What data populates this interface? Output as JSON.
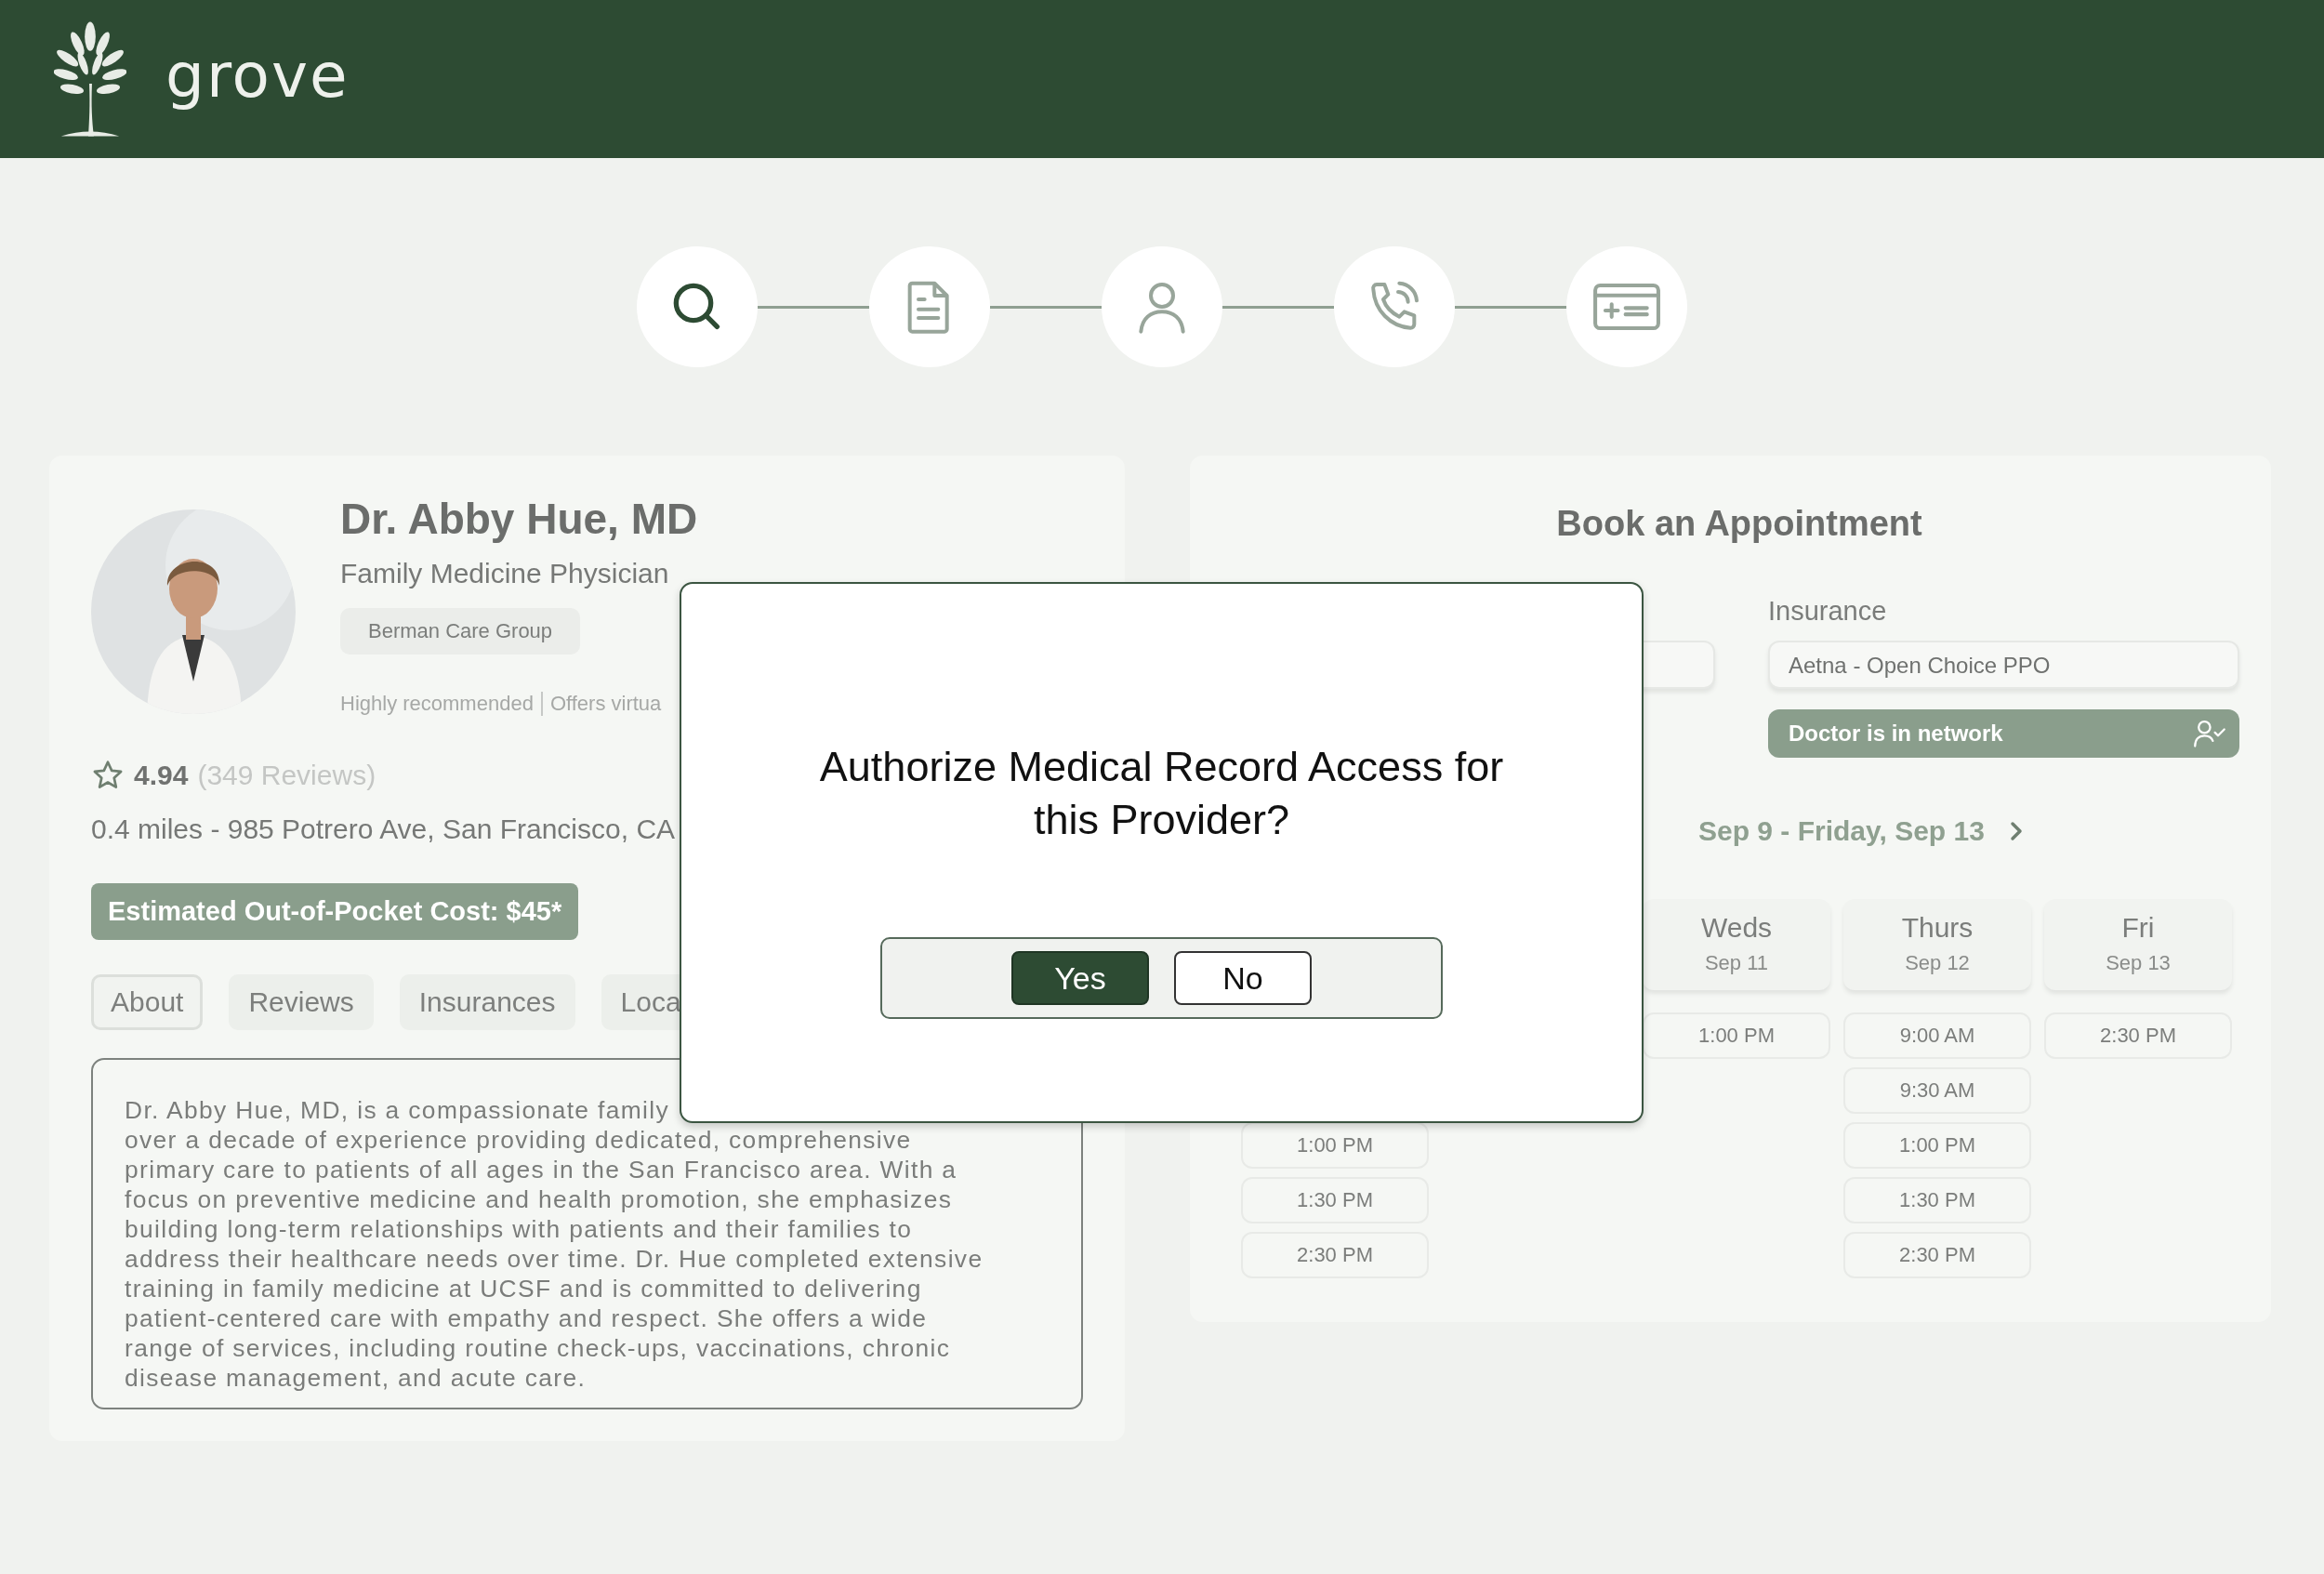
{
  "header": {
    "brand": "grove"
  },
  "steps": [
    {
      "kind": "search",
      "selected": true
    },
    {
      "kind": "document",
      "selected": false
    },
    {
      "kind": "person",
      "selected": false
    },
    {
      "kind": "phone",
      "selected": false
    },
    {
      "kind": "billing",
      "selected": false
    }
  ],
  "profile": {
    "name": "Dr. Abby Hue, MD",
    "specialty": "Family Medicine Physician",
    "group": "Berman Care Group",
    "highlights": [
      "Highly recommended",
      "Offers virtua"
    ],
    "rating": "4.94",
    "reviews": "(349 Reviews)",
    "address": "0.4 miles - 985 Potrero Ave, San Francisco, CA",
    "cost": "Estimated Out-of-Pocket Cost: $45*",
    "tabs": [
      {
        "label": "About",
        "selected": true
      },
      {
        "label": "Reviews",
        "selected": false
      },
      {
        "label": "Insurances",
        "selected": false
      },
      {
        "label": "Loca",
        "selected": false
      }
    ],
    "about_lines": [
      "Dr. Abby Hue, MD, is a compassionate family",
      "over a decade of experience providing dedicated, comprehensive",
      "primary care to patients of all ages in the San Francisco area. With a",
      "focus on preventive medicine and health promotion, she emphasizes",
      "building long-term relationships with patients and their families to",
      "address their healthcare needs over time. Dr. Hue completed extensive",
      "training in family medicine at UCSF and is committed to delivering",
      "patient-centered care with empathy and respect. She offers a wide",
      "range of services, including routine check-ups, vaccinations, chronic",
      "disease management, and acute care."
    ]
  },
  "booking": {
    "title": "Book an Appointment",
    "insurance_label": "Insurance",
    "insurance_value": "Aetna - Open Choice PPO",
    "network_status": "Doctor is in network",
    "week": "Sep 9 - Friday, Sep 13",
    "columns": [
      {
        "slots": [
          "1:00 PM",
          "1:30 PM",
          "2:30 PM"
        ]
      },
      {
        "day": "Weds",
        "date": "Sep 11",
        "slots": [
          "1:00 PM"
        ]
      },
      {
        "day": "Thurs",
        "date": "Sep 12",
        "slots": [
          "9:00 AM",
          "9:30 AM",
          "1:00 PM",
          "1:30 PM",
          "2:30 PM"
        ]
      },
      {
        "day": "Fri",
        "date": "Sep 13",
        "slots": [
          "2:30 PM"
        ]
      }
    ]
  },
  "dialog": {
    "title": "Authorize Medical Record Access for this Provider?",
    "buttons": [
      {
        "label": "Yes",
        "kind": "primary"
      },
      {
        "label": "No",
        "kind": "secondary"
      }
    ]
  }
}
